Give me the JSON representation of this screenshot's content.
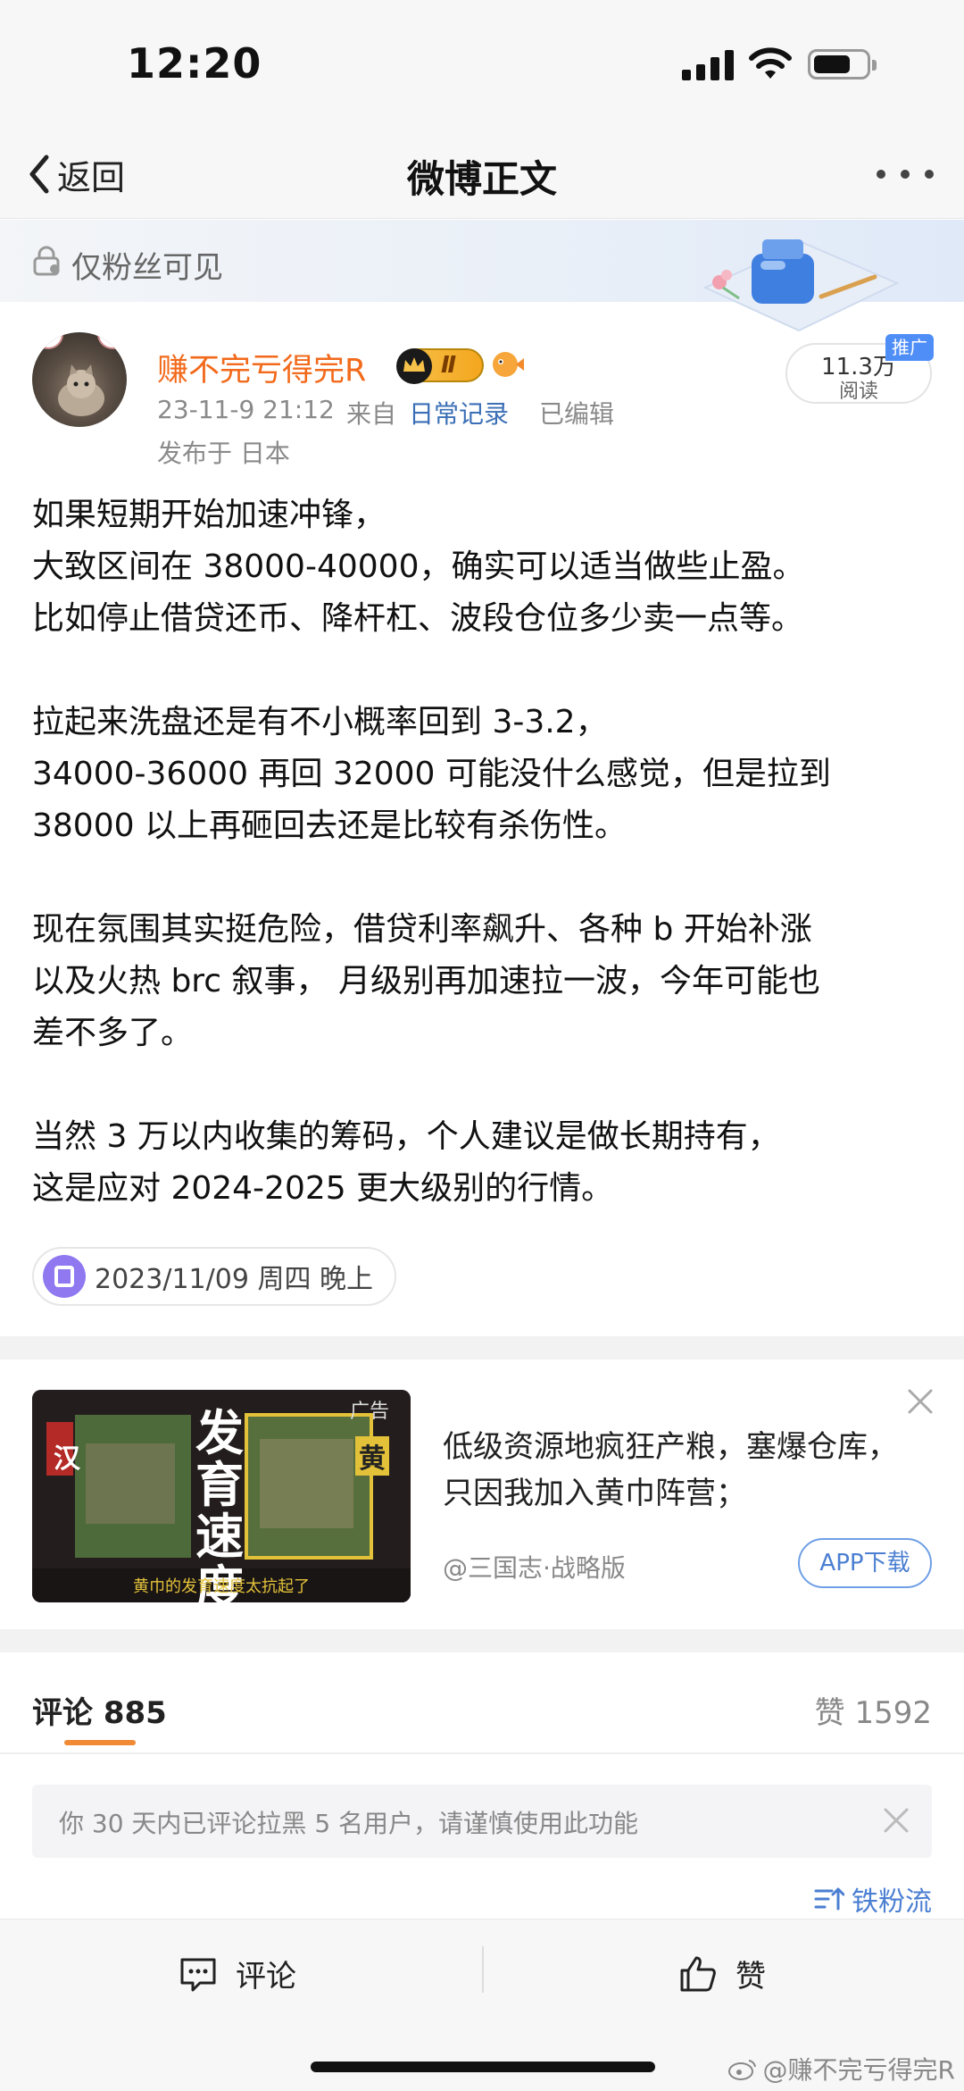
{
  "status_bar": {
    "time": "12:20"
  },
  "nav": {
    "back_label": "返回",
    "title": "微博正文"
  },
  "banner": {
    "visibility_text": "仅粉丝可见"
  },
  "author": {
    "name": "赚不完亏得完R",
    "vip_level": "Ⅱ",
    "post_time": "23-11-9 21:12",
    "source_prefix": "来自",
    "source": "日常记录",
    "edited": "已编辑",
    "location": "发布于 日本"
  },
  "reads": {
    "count": "11.3万",
    "label": "阅读",
    "promo_tag": "推广"
  },
  "post": {
    "lines": [
      "如果短期开始加速冲锋，",
      "大致区间在 38000-40000，确实可以适当做些止盈。",
      "比如停止借贷还币、降杆杠、波段仓位多少卖一点等。",
      "",
      "拉起来洗盘还是有不小概率回到 3-3.2，",
      "34000-36000 再回 32000 可能没什么感觉，但是拉到",
      "38000 以上再砸回去还是比较有杀伤性。",
      "",
      "现在氛围其实挺危险，借贷利率飙升、各种 b 开始补涨",
      "以及火热 brc 叙事， 月级别再加速拉一波，今年可能也",
      "差不多了。",
      "",
      "当然 3 万以内收集的筹码，个人建议是做长期持有，",
      "这是应对 2024-2025 更大级别的行情。"
    ],
    "date_tag": "2023/11/09 周四 晚上"
  },
  "ad": {
    "label": "广告",
    "image_text_big": "发育速度",
    "image_text_left": "汉",
    "image_text_right": "黄",
    "image_caption": "黄巾的发育速度太抗起了",
    "title": "低级资源地疯狂产粮，塞爆仓库，只因我加入黄巾阵营；",
    "sponsor": "@三国志·战略版",
    "download_label": "APP下载"
  },
  "comments": {
    "tab_label": "评论 885",
    "likes_label": "赞 1592",
    "notice": "你 30 天内已评论拉黑 5 名用户，请谨慎使用此功能",
    "sort_label": "铁粉流"
  },
  "toolbar": {
    "comment_label": "评论",
    "like_label": "赞"
  },
  "watermark": "@赚不完亏得完R",
  "colors": {
    "accent_orange": "#f26a1b",
    "link_blue": "#3b6fb6",
    "underline": "#f08a35",
    "promo_blue": "#4f8ef7"
  }
}
